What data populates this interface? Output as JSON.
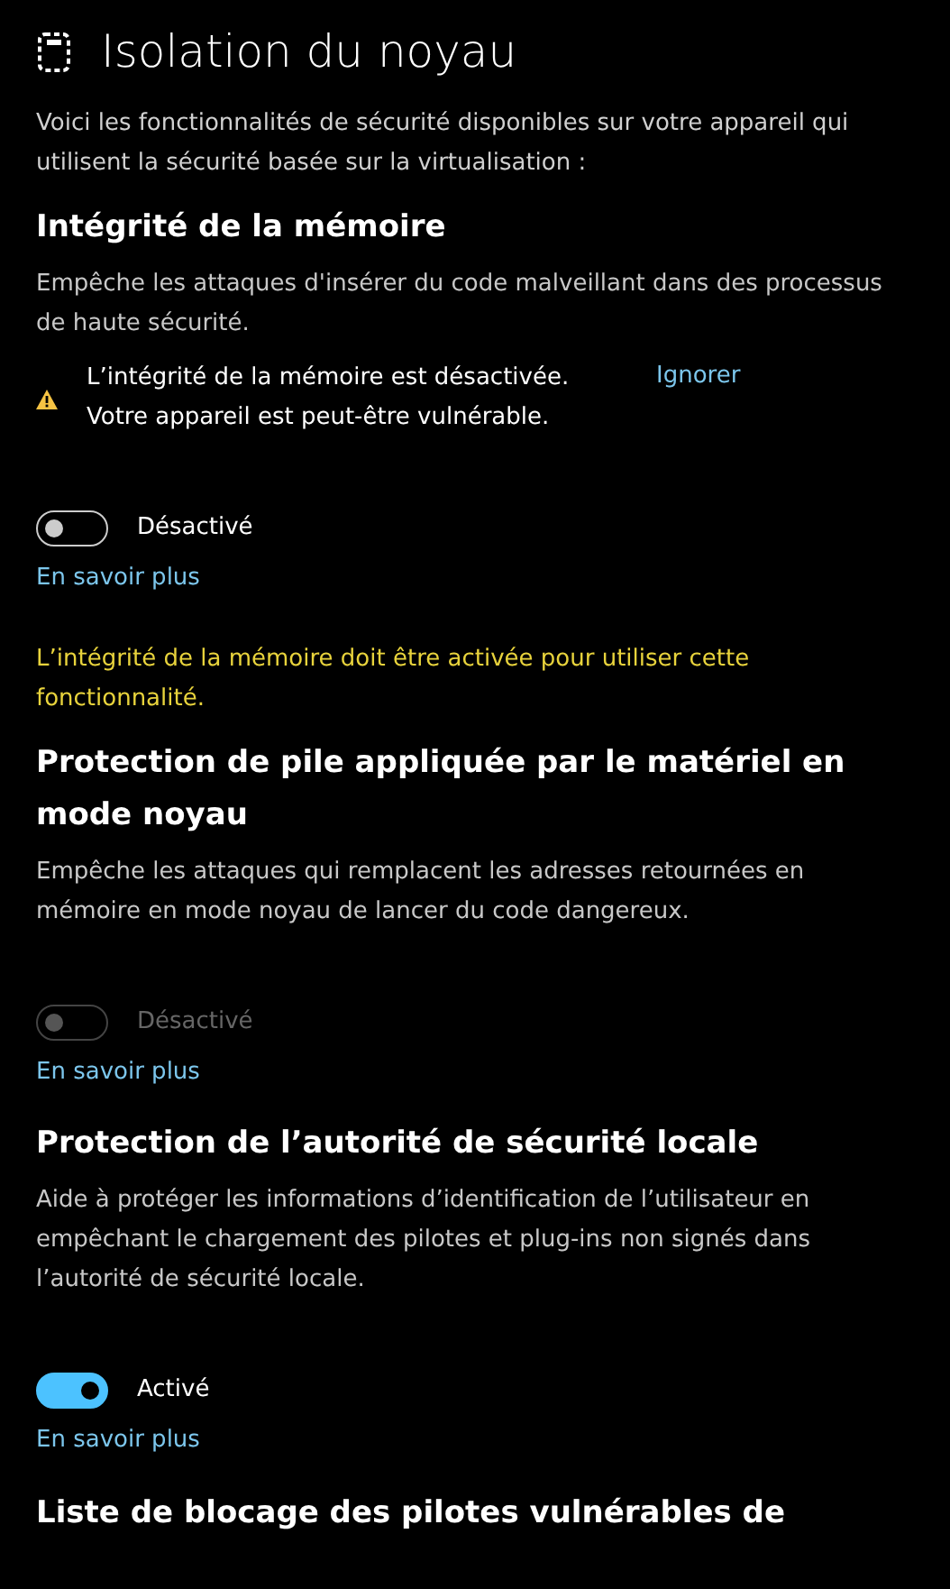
{
  "page": {
    "title": "Isolation du noyau",
    "intro": "Voici les fonctionnalités de sécurité disponibles sur votre appareil qui utilisent la sécurité basée sur la virtualisation :"
  },
  "sections": [
    {
      "heading": "Intégrité de la mémoire",
      "description": "Empêche les attaques d'insérer du code malveillant dans des processus de haute sécurité.",
      "warning": {
        "text": "L’intégrité de la mémoire est désactivée. Votre appareil est peut-être vulnérable.",
        "action": "Ignorer"
      },
      "toggle": {
        "on": false,
        "disabled": false,
        "label": "Désactivé"
      },
      "link": "En savoir plus"
    },
    {
      "notice": "L’intégrité de la mémoire doit être activée pour utiliser cette fonctionnalité.",
      "heading": "Protection de pile appliquée par le matériel en mode noyau",
      "description": "Empêche les attaques qui remplacent les adresses retournées en mémoire en mode noyau de lancer du code dangereux.",
      "toggle": {
        "on": false,
        "disabled": true,
        "label": "Désactivé"
      },
      "link": "En savoir plus"
    },
    {
      "heading": "Protection de l’autorité de sécurité locale",
      "description": "Aide à protéger les informations d’identification de l’utilisateur en empêchant le chargement des pilotes et plug-ins non signés dans l’autorité de sécurité locale.",
      "toggle": {
        "on": true,
        "disabled": false,
        "label": "Activé"
      },
      "link": "En savoir plus"
    },
    {
      "heading": "Liste de blocage des pilotes vulnérables de"
    }
  ]
}
